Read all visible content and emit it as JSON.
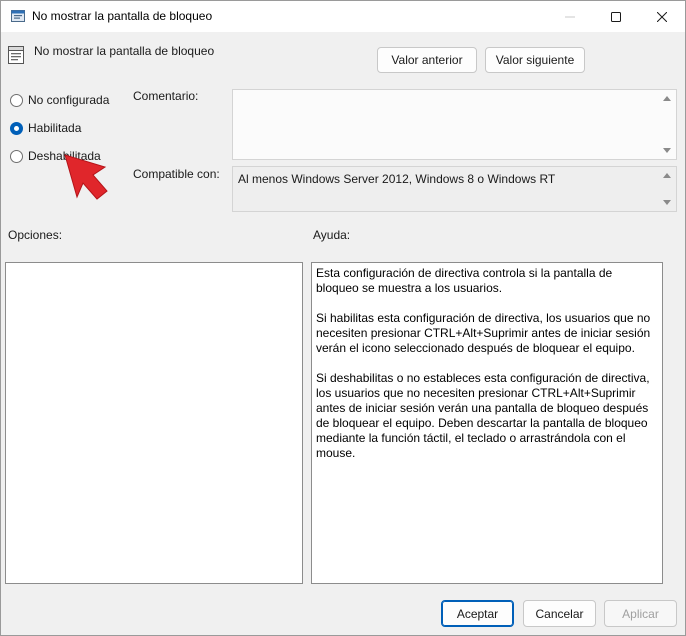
{
  "window": {
    "title": "No mostrar la pantalla de bloqueo"
  },
  "header": {
    "policy_name": "No mostrar la pantalla de bloqueo",
    "prev_button": "Valor anterior",
    "next_button": "Valor siguiente"
  },
  "state": {
    "options": [
      {
        "label": "No configurada",
        "checked": false
      },
      {
        "label": "Habilitada",
        "checked": true
      },
      {
        "label": "Deshabilitada",
        "checked": false
      }
    ]
  },
  "comment": {
    "label": "Comentario:",
    "value": ""
  },
  "supported": {
    "label": "Compatible con:",
    "value": "Al menos Windows Server 2012, Windows 8 o Windows RT"
  },
  "sections": {
    "options_label": "Opciones:",
    "help_label": "Ayuda:"
  },
  "help": {
    "paragraphs": [
      "Esta configuración de directiva controla si la pantalla de bloqueo se muestra a los usuarios.",
      "Si habilitas esta configuración de directiva, los usuarios que no necesiten presionar CTRL+Alt+Suprimir antes de iniciar sesión verán el icono seleccionado después de bloquear el equipo.",
      "Si deshabilitas o no estableces esta configuración de directiva, los usuarios que no necesiten presionar CTRL+Alt+Suprimir antes de iniciar sesión verán una pantalla de bloqueo después de bloquear el equipo. Deben descartar la pantalla de bloqueo mediante la función táctil, el teclado o arrastrándola con el mouse."
    ]
  },
  "footer": {
    "ok_button": "Aceptar",
    "cancel_button": "Cancelar",
    "apply_button": "Aplicar"
  },
  "colors": {
    "accent": "#005fb8",
    "annotation_arrow": "#e0262b"
  },
  "icons": {
    "title": "policy-settings-icon",
    "minimize": "minimize-icon",
    "maximize": "maximize-icon",
    "close": "close-icon",
    "arrow": "pointer-arrow-annotation"
  }
}
